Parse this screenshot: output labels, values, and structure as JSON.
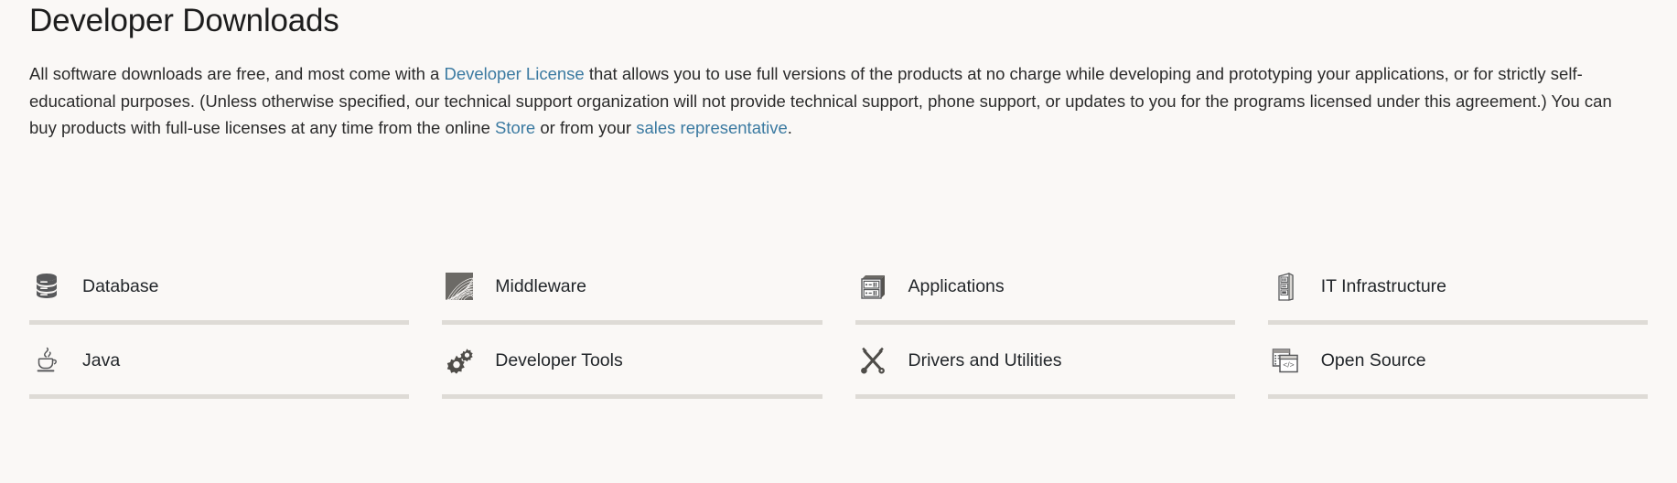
{
  "header": {
    "title": "Developer Downloads"
  },
  "intro": {
    "part1": "All software downloads are free, and most come with a ",
    "link1": "Developer License",
    "part2": " that allows you to use full versions of the products at no charge while developing and prototyping your applications, or for strictly self-educational purposes. (Unless otherwise specified, our technical support organization will not provide technical support, phone support, or updates to you for the programs licensed under this agreement.) You can buy products with full-use licenses at any time from the online ",
    "link2": "Store",
    "part3": " or from your ",
    "link3": "sales representative",
    "part4": "."
  },
  "categories": [
    {
      "label": "Database",
      "icon": "database-icon"
    },
    {
      "label": "Middleware",
      "icon": "middleware-icon"
    },
    {
      "label": "Applications",
      "icon": "applications-icon"
    },
    {
      "label": "IT Infrastructure",
      "icon": "it-infrastructure-icon"
    },
    {
      "label": "Java",
      "icon": "java-icon"
    },
    {
      "label": "Developer Tools",
      "icon": "developer-tools-icon"
    },
    {
      "label": "Drivers and Utilities",
      "icon": "drivers-utilities-icon"
    },
    {
      "label": "Open Source",
      "icon": "open-source-icon"
    }
  ],
  "colors": {
    "background": "#faf8f6",
    "link": "#3b7aa1",
    "text": "#2b2b2b",
    "icon": "#58595b",
    "divider": "#dedbd6"
  }
}
